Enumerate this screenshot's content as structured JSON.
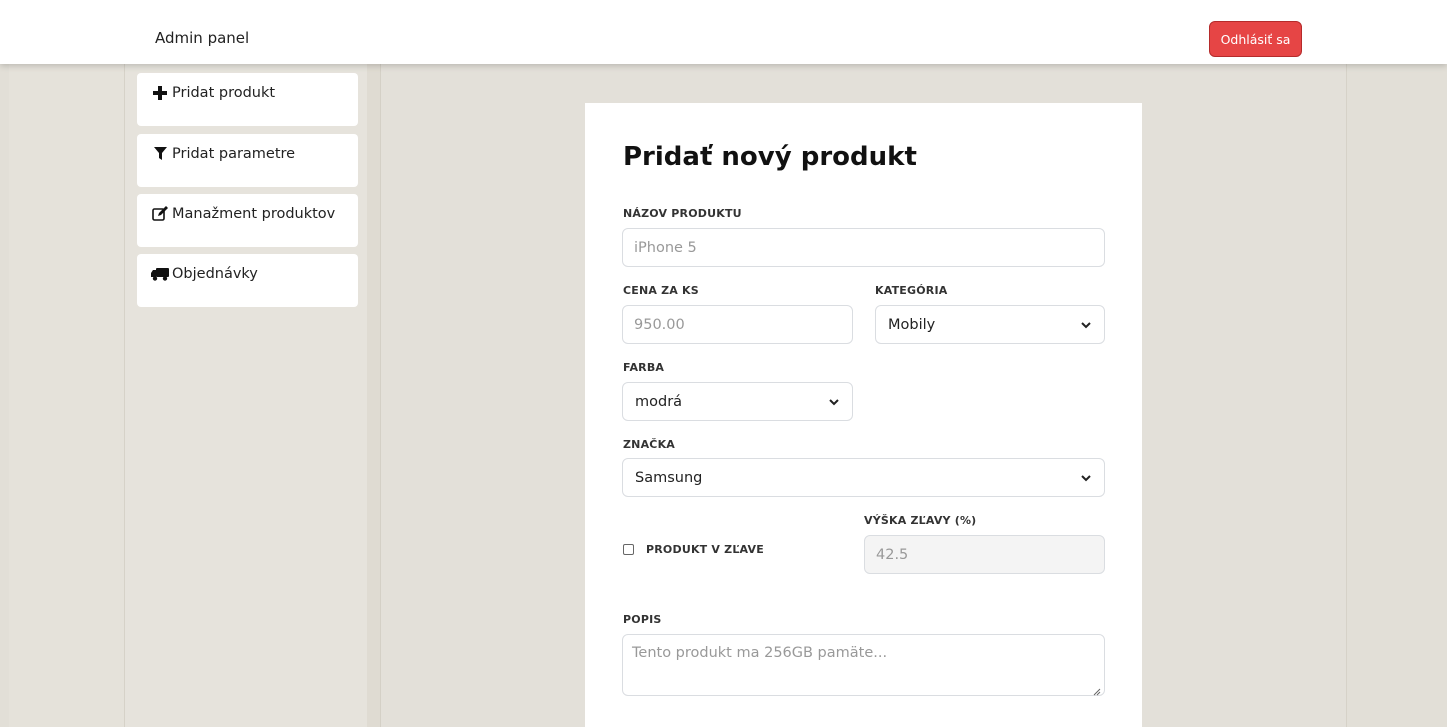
{
  "navbar": {
    "brand": "Admin panel",
    "logout_label": "Odhlásiť sa"
  },
  "sidebar": {
    "items": [
      {
        "label": "Pridat produkt",
        "icon": "plus-icon"
      },
      {
        "label": "Pridat parametre",
        "icon": "filter-icon"
      },
      {
        "label": "Manažment produktov",
        "icon": "edit-icon"
      },
      {
        "label": "Objednávky",
        "icon": "truck-icon"
      }
    ]
  },
  "form": {
    "title": "Pridať nový produkt",
    "name": {
      "label": "NÁZOV PRODUKTU",
      "placeholder": "iPhone 5"
    },
    "price": {
      "label": "CENA ZA KS",
      "placeholder": "950.00"
    },
    "category": {
      "label": "KATEGÓRIA",
      "value": "Mobily"
    },
    "color": {
      "label": "FARBA",
      "value": "modrá"
    },
    "brand": {
      "label": "ZNAČKA",
      "value": "Samsung"
    },
    "sale": {
      "label": "PRODUKT V ZĽAVE",
      "checked": false
    },
    "discount": {
      "label": "VÝŠKA ZĽAVY (%)",
      "placeholder": "42.5"
    },
    "description": {
      "label": "POPIS",
      "placeholder": "Tento produkt ma 256GB pamäte..."
    }
  },
  "colors": {
    "logout_bg": "#e64545",
    "page_bg": "#e2dfd7",
    "card_bg": "#ffffff"
  }
}
